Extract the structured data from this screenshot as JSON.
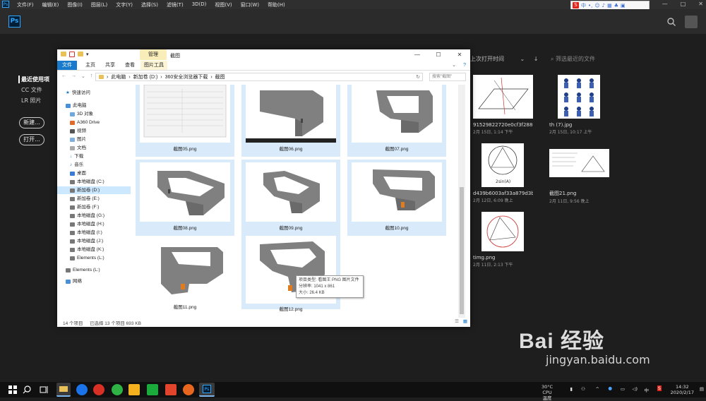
{
  "ps_menubar": {
    "menus": [
      "文件(F)",
      "编辑(E)",
      "图像(I)",
      "图层(L)",
      "文字(Y)",
      "选择(S)",
      "滤镜(T)",
      "3D(D)",
      "视图(V)",
      "窗口(W)",
      "帮助(H)"
    ],
    "ime_label": "中",
    "window_controls": [
      "—",
      "□",
      "✕"
    ]
  },
  "ps_home": {
    "logo": "Ps",
    "nav": [
      "最近使用项",
      "CC 文件",
      "LR 照片"
    ],
    "new_button": "新建...",
    "open_button": "打开...",
    "sort_label": "上次打开时间",
    "filter_placeholder": "筛选最近的文件",
    "files": [
      {
        "name": "91529822720e0cf3f288021...",
        "date": "2月 15日, 1:14 下午"
      },
      {
        "name": "th (7).jpg",
        "date": "2月 15日, 10:17 上午"
      },
      {
        "name": "d439b6003af33a879d3bd2...",
        "date": "2月 12日, 6:09 晚上"
      },
      {
        "name": "截图21.png",
        "date": "2月 11日, 9:56 晚上"
      },
      {
        "name": "timg.png",
        "date": "2月 11日, 2:13 下午"
      }
    ]
  },
  "explorer": {
    "manage_tab": "管理",
    "title": "截图",
    "tabs": [
      "文件",
      "主页",
      "共享",
      "查看",
      "图片工具"
    ],
    "path": [
      "此电脑",
      "新加卷 (D:)",
      "360安全浏览器下载",
      "截图"
    ],
    "search_placeholder": "搜索\"截图\"",
    "nav_items": [
      "快速访问",
      "此电脑",
      "3D 对象",
      "A360 Drive",
      "视频",
      "图片",
      "文档",
      "下载",
      "音乐",
      "桌面",
      "本地磁盘 (C:)",
      "新加卷 (D:)",
      "新加卷 (E:)",
      "新加卷 (F:)",
      "本地磁盘 (G:)",
      "本地磁盘 (H:)",
      "本地磁盘 (I:)",
      "本地磁盘 (J:)",
      "本地磁盘 (K:)",
      "Elements (L:)",
      "Elements (L:)",
      "网络"
    ],
    "files": [
      "截图05.png",
      "截图06.png",
      "截图07.png",
      "截图08.png",
      "截图09.png",
      "截图10.png",
      "截图11.png",
      "截图12.png"
    ],
    "tooltip": {
      "type": "项目类型: 看图王 PNG 图片文件",
      "dimensions": "分辨率: 1041 x 861",
      "size": "大小: 26.4 KB"
    },
    "status": {
      "count": "14 个项目",
      "selection": "已选择 13 个项目  693 KB"
    }
  },
  "taskbar": {
    "weather_temp": "30°C",
    "weather_label": "CPU温度",
    "time": "14:32",
    "date": "2020/2/17",
    "ime": "中"
  },
  "watermark": {
    "brand": "Bai 经验",
    "url": "jingyan.baidu.com"
  }
}
